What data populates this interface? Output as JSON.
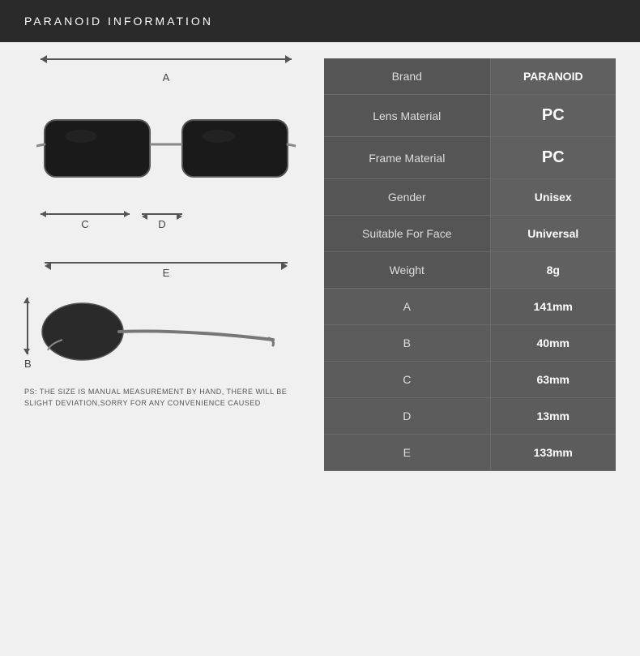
{
  "header": {
    "title": "PARANOID   INFORMATION"
  },
  "left": {
    "dimension_a_label": "A",
    "dimension_b_label": "B",
    "dimension_c_label": "C",
    "dimension_d_label": "D",
    "dimension_e_label": "E",
    "footnote": "PS: THE SIZE IS MANUAL MEASUREMENT BY HAND, THERE WILL BE SLIGHT DEVIATION,SORRY FOR ANY CONVENIENCE CAUSED"
  },
  "table": {
    "rows": [
      {
        "label": "Brand",
        "value": "PARANOID",
        "large": false
      },
      {
        "label": "Lens Material",
        "value": "PC",
        "large": true
      },
      {
        "label": "Frame Material",
        "value": "PC",
        "large": true
      },
      {
        "label": "Gender",
        "value": "Unisex",
        "large": false
      },
      {
        "label": "Suitable For Face",
        "value": "Universal",
        "large": false
      },
      {
        "label": "Weight",
        "value": "8g",
        "large": false
      },
      {
        "label": "A",
        "value": "141mm",
        "large": false
      },
      {
        "label": "B",
        "value": "40mm",
        "large": false
      },
      {
        "label": "C",
        "value": "63mm",
        "large": false
      },
      {
        "label": "D",
        "value": "13mm",
        "large": false
      },
      {
        "label": "E",
        "value": "133mm",
        "large": false
      }
    ]
  }
}
